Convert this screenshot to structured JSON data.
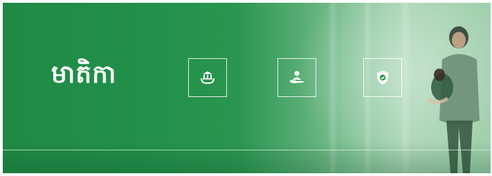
{
  "banner": {
    "title": "មាតិកា",
    "icons": [
      "bank-hands-icon",
      "person-care-icon",
      "shield-check-icon"
    ],
    "colors": {
      "primary_green": "#22904a",
      "light_green": "#a9d4b4",
      "icon_white": "#ffffff"
    }
  }
}
